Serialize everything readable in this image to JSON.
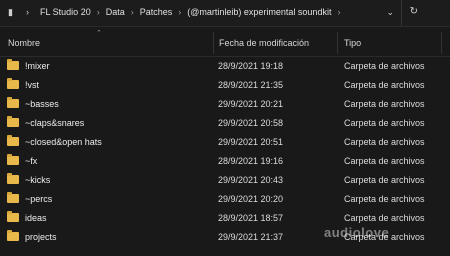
{
  "address_bar": {
    "breadcrumbs": [
      "FL Studio 20",
      "Data",
      "Patches",
      "(@martinleib) experimental soundkit"
    ],
    "nav_icon": "chevron-right-icon",
    "expand_icon": "chevron-down-icon",
    "refresh_icon": "refresh-icon"
  },
  "columns": {
    "name": "Nombre",
    "date": "Fecha de modificación",
    "type": "Tipo"
  },
  "rows": [
    {
      "name": "!mixer",
      "date": "28/9/2021 19:18",
      "type": "Carpeta de archivos"
    },
    {
      "name": "!vst",
      "date": "28/9/2021 21:35",
      "type": "Carpeta de archivos"
    },
    {
      "name": "~basses",
      "date": "29/9/2021 20:21",
      "type": "Carpeta de archivos"
    },
    {
      "name": "~claps&snares",
      "date": "29/9/2021 20:58",
      "type": "Carpeta de archivos"
    },
    {
      "name": "~closed&open hats",
      "date": "29/9/2021 20:51",
      "type": "Carpeta de archivos"
    },
    {
      "name": "~fx",
      "date": "28/9/2021 19:16",
      "type": "Carpeta de archivos"
    },
    {
      "name": "~kicks",
      "date": "29/9/2021 20:43",
      "type": "Carpeta de archivos"
    },
    {
      "name": "~percs",
      "date": "29/9/2021 20:20",
      "type": "Carpeta de archivos"
    },
    {
      "name": "ideas",
      "date": "28/9/2021 18:57",
      "type": "Carpeta de archivos"
    },
    {
      "name": "projects",
      "date": "29/9/2021 21:37",
      "type": "Carpeta de archivos"
    }
  ],
  "watermark": "audiolove",
  "colors": {
    "background": "#191919",
    "folder": "#e8b84a",
    "text": "#e6e6e6"
  }
}
